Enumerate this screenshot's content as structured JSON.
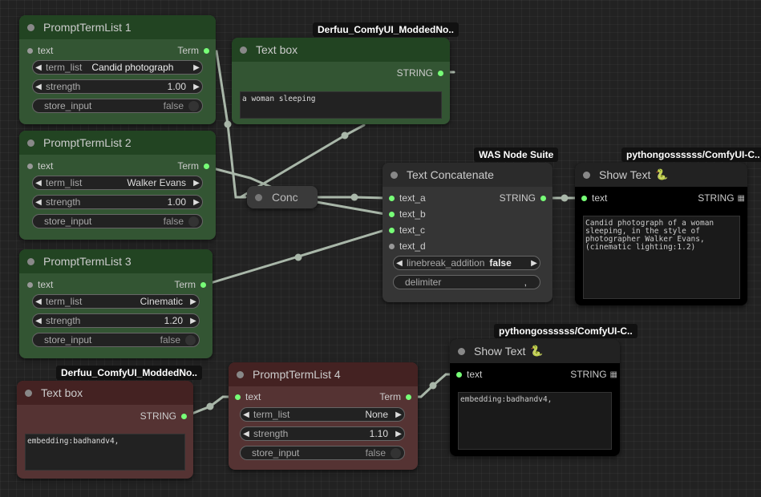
{
  "nodes": {
    "ptl1": {
      "title": "PromptTermList 1",
      "input": "text",
      "output": "Term",
      "term_list_label": "term_list",
      "term_list_value": "Candid photograph",
      "strength_label": "strength",
      "strength_value": "1.00",
      "store_label": "store_input",
      "store_value": "false"
    },
    "ptl2": {
      "title": "PromptTermList 2",
      "input": "text",
      "output": "Term",
      "term_list_label": "term_list",
      "term_list_value": "Walker Evans",
      "strength_label": "strength",
      "strength_value": "1.00",
      "store_label": "store_input",
      "store_value": "false"
    },
    "ptl3": {
      "title": "PromptTermList 3",
      "input": "text",
      "output": "Term",
      "term_list_label": "term_list",
      "term_list_value": "Cinematic",
      "strength_label": "strength",
      "strength_value": "1.20",
      "store_label": "store_input",
      "store_value": "false"
    },
    "ptl4": {
      "title": "PromptTermList 4",
      "input": "text",
      "output": "Term",
      "term_list_label": "term_list",
      "term_list_value": "None",
      "strength_label": "strength",
      "strength_value": "1.10",
      "store_label": "store_input",
      "store_value": "false"
    },
    "textbox1": {
      "badge": "Derfuu_ComfyUI_ModdedNo..",
      "title": "Text box",
      "output": "STRING",
      "text": "a woman sleeping"
    },
    "textbox2": {
      "badge": "Derfuu_ComfyUI_ModdedNo..",
      "title": "Text box",
      "output": "STRING",
      "text": "embedding:badhandv4,"
    },
    "conc": {
      "title": "Conc"
    },
    "concat": {
      "badge": "WAS Node Suite",
      "title": "Text Concatenate",
      "in_a": "text_a",
      "in_b": "text_b",
      "in_c": "text_c",
      "in_d": "text_d",
      "output": "STRING",
      "linebreak_label": "linebreak_addition",
      "linebreak_value": "false",
      "delimiter_label": "delimiter",
      "delimiter_value": ","
    },
    "show1": {
      "badge": "pythongossssss/ComfyUI-C..",
      "title": "Show Text",
      "input": "text",
      "output": "STRING",
      "text": "Candid photograph of a woman sleeping, in the style of photographer Walker Evans, (cinematic lighting:1.2)"
    },
    "show2": {
      "badge": "pythongossssss/ComfyUI-C..",
      "title": "Show Text",
      "input": "text",
      "output": "STRING",
      "text": "embedding:badhandv4,"
    }
  },
  "icons": {
    "snake": "snake-icon",
    "grid": "grid-icon"
  },
  "colors": {
    "canvas": "#222222",
    "green_node": "#335533",
    "red_node": "#553333",
    "wire": "#aab8aa",
    "pin": "#77ff77"
  }
}
